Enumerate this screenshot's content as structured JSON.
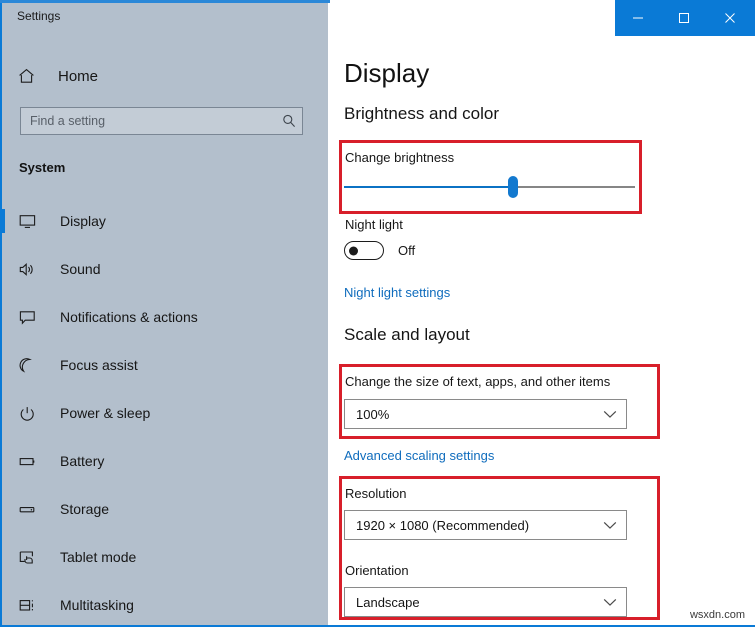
{
  "window": {
    "app_title": "Settings",
    "controls": {
      "minimize": "minimize",
      "maximize": "maximize",
      "close": "close"
    },
    "titlebar_color": "#0a7ad6"
  },
  "sidebar": {
    "home_label": "Home",
    "home_icon": "home-icon",
    "search": {
      "placeholder": "Find a setting",
      "value": "",
      "icon": "search-icon"
    },
    "section_label": "System",
    "items": [
      {
        "label": "Display",
        "icon": "monitor-icon",
        "selected": true
      },
      {
        "label": "Sound",
        "icon": "speaker-icon",
        "selected": false
      },
      {
        "label": "Notifications & actions",
        "icon": "notification-icon",
        "selected": false
      },
      {
        "label": "Focus assist",
        "icon": "moon-icon",
        "selected": false
      },
      {
        "label": "Power & sleep",
        "icon": "power-icon",
        "selected": false
      },
      {
        "label": "Battery",
        "icon": "battery-icon",
        "selected": false
      },
      {
        "label": "Storage",
        "icon": "drive-icon",
        "selected": false
      },
      {
        "label": "Tablet mode",
        "icon": "tablet-hand-icon",
        "selected": false
      },
      {
        "label": "Multitasking",
        "icon": "multitask-icon",
        "selected": false
      }
    ],
    "accent_color": "#0a7ad6",
    "background_color": "#b3bfcc"
  },
  "main": {
    "page_title": "Display",
    "brightness_group": {
      "title": "Brightness and color",
      "change_brightness_label": "Change brightness",
      "slider_percent": 58,
      "night_light_label": "Night light",
      "night_light_state": "Off",
      "night_light_on": false,
      "night_light_settings_link": "Night light settings"
    },
    "scale_group": {
      "title": "Scale and layout",
      "scale_label": "Change the size of text, apps, and other items",
      "scale_value": "100%",
      "advanced_scaling_link": "Advanced scaling settings",
      "resolution_label": "Resolution",
      "resolution_value": "1920 × 1080 (Recommended)",
      "orientation_label": "Orientation",
      "orientation_value": "Landscape"
    },
    "link_color": "#0f6cbd",
    "highlight_color": "#d81f2a"
  },
  "watermark": "wsxdn.com"
}
